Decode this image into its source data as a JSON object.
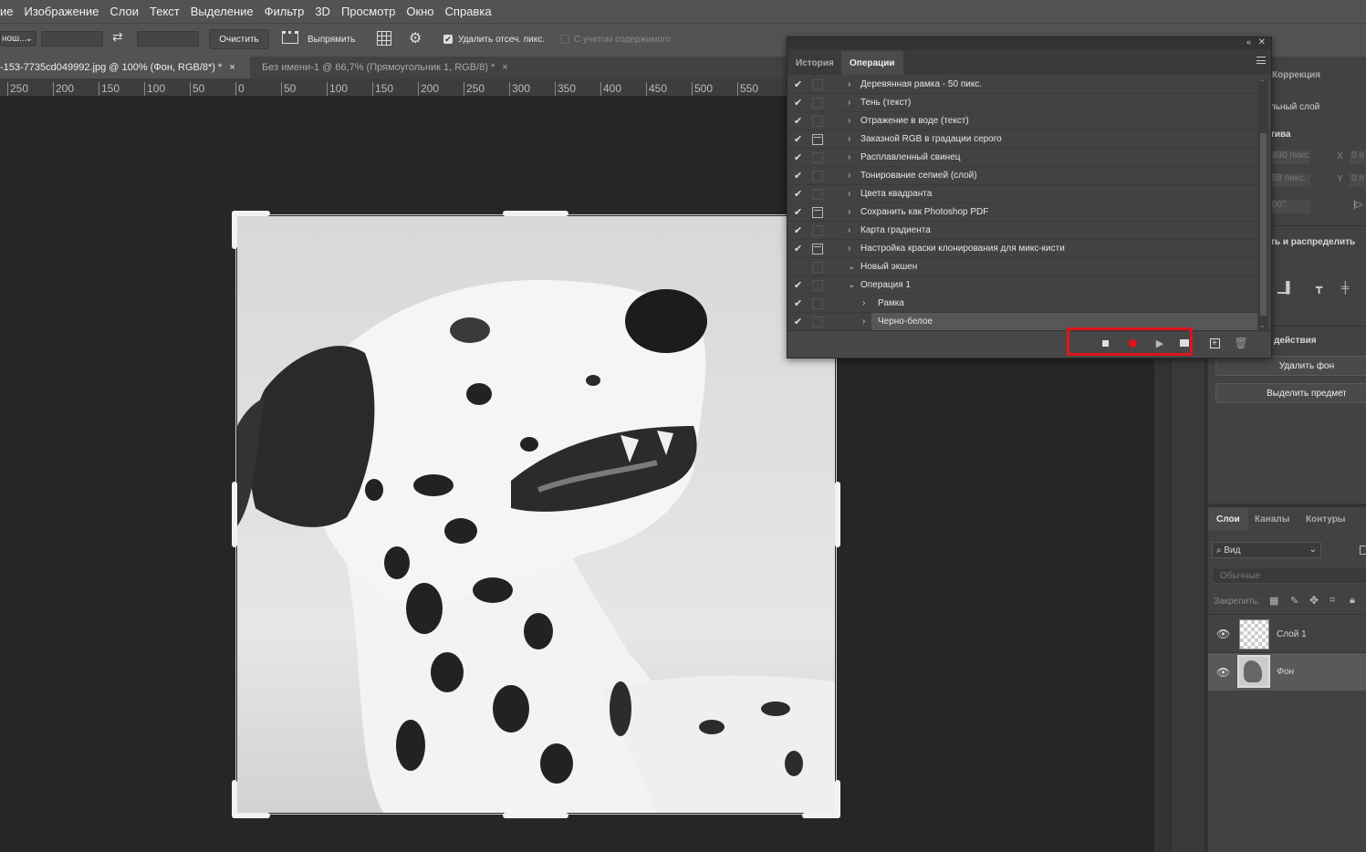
{
  "menu": [
    "ие",
    "Изображение",
    "Слои",
    "Текст",
    "Выделение",
    "Фильтр",
    "3D",
    "Просмотр",
    "Окно",
    "Справка"
  ],
  "options": {
    "ratio_label": "нош...",
    "clear_button": "Очистить",
    "straighten_button": "Выпрямить",
    "delete_cropped_label": "Удалить отсеч. пикс.",
    "content_aware_label": "С учетом содержимого"
  },
  "doc_tabs": [
    {
      "title": "-153-7735cd049992.jpg @ 100% (Фон, RGB/8*) *",
      "close": "×",
      "active": true
    },
    {
      "title": "Без имени-1 @ 66,7% (Прямоугольник 1, RGB/8) *",
      "close": "×",
      "active": false
    }
  ],
  "ruler_ticks": [
    "250",
    "200",
    "150",
    "100",
    "50",
    "0",
    "50",
    "100",
    "150",
    "200",
    "250",
    "300",
    "350",
    "400",
    "450",
    "500",
    "550"
  ],
  "actions_panel": {
    "tabs": [
      "История",
      "Операции"
    ],
    "active_tab": "Операции",
    "rows": [
      {
        "check": "✔",
        "dialog": false,
        "arrow": "›",
        "label": "Деревянная рамка - 50 пикс.",
        "indent": 0
      },
      {
        "check": "✔",
        "dialog": false,
        "arrow": "›",
        "label": "Тень (текст)",
        "indent": 0
      },
      {
        "check": "✔",
        "dialog": false,
        "arrow": "›",
        "label": "Отражение в воде (текст)",
        "indent": 0
      },
      {
        "check": "✔",
        "dialog": true,
        "arrow": "›",
        "label": "Заказной RGB в градации серого",
        "indent": 0
      },
      {
        "check": "✔",
        "dialog": false,
        "arrow": "›",
        "label": "Расплавленный свинец",
        "indent": 0
      },
      {
        "check": "✔",
        "dialog": false,
        "arrow": "›",
        "label": "Тонирование сепией (слой)",
        "indent": 0
      },
      {
        "check": "✔",
        "dialog": false,
        "arrow": "›",
        "label": "Цвета квадранта",
        "indent": 0
      },
      {
        "check": "✔",
        "dialog": true,
        "arrow": "›",
        "label": "Сохранить как Photoshop PDF",
        "indent": 0
      },
      {
        "check": "✔",
        "dialog": false,
        "arrow": "›",
        "label": "Карта градиента",
        "indent": 0
      },
      {
        "check": "✔",
        "dialog": true,
        "arrow": "›",
        "label": "Настройка краски клонирования для микс-кисти",
        "indent": 0
      },
      {
        "check": "",
        "dialog": false,
        "arrow": "⌄",
        "label": "Новый экшен",
        "indent": 0
      },
      {
        "check": "✔",
        "dialog": false,
        "arrow": "⌄",
        "label": "Операция 1",
        "indent": 0
      },
      {
        "check": "✔",
        "dialog": false,
        "arrow": "›",
        "label": "Рамка",
        "indent": 1
      },
      {
        "check": "✔",
        "dialog": false,
        "arrow": "›",
        "label": "Черно-белое",
        "indent": 1
      }
    ],
    "footer_icons": [
      "stop-icon",
      "record-icon",
      "play-icon",
      "new-set-icon",
      "new-action-icon",
      "trash-icon"
    ],
    "record_color": "#e0141a"
  },
  "right_panel": {
    "tab": "Коррекция",
    "layer_label": "льный слой",
    "props_label": "тива",
    "w_value": "490 пикс.",
    "h_value": "58 пикс.",
    "angle_value": "00°",
    "x_label": "X",
    "y_label": "Y",
    "x_value": "0 п",
    "y_value": "0 п",
    "align_label": "ть и распределить",
    "quick_actions_label": "действия",
    "remove_bg_button": "Удалить фон",
    "select_subject_button": "Выделить предмет"
  },
  "layers_panel": {
    "tabs": [
      "Слои",
      "Каналы",
      "Контуры"
    ],
    "filter_label": "Вид",
    "blend_mode": "Обычные",
    "lock_label": "Закрепить:",
    "layers": [
      {
        "name": "Слой 1",
        "selected": false
      },
      {
        "name": "Фон",
        "selected": true
      }
    ]
  },
  "colors": {
    "accent_red": "#e0141a",
    "panel_bg": "#424242",
    "menu_bg": "#535353"
  }
}
